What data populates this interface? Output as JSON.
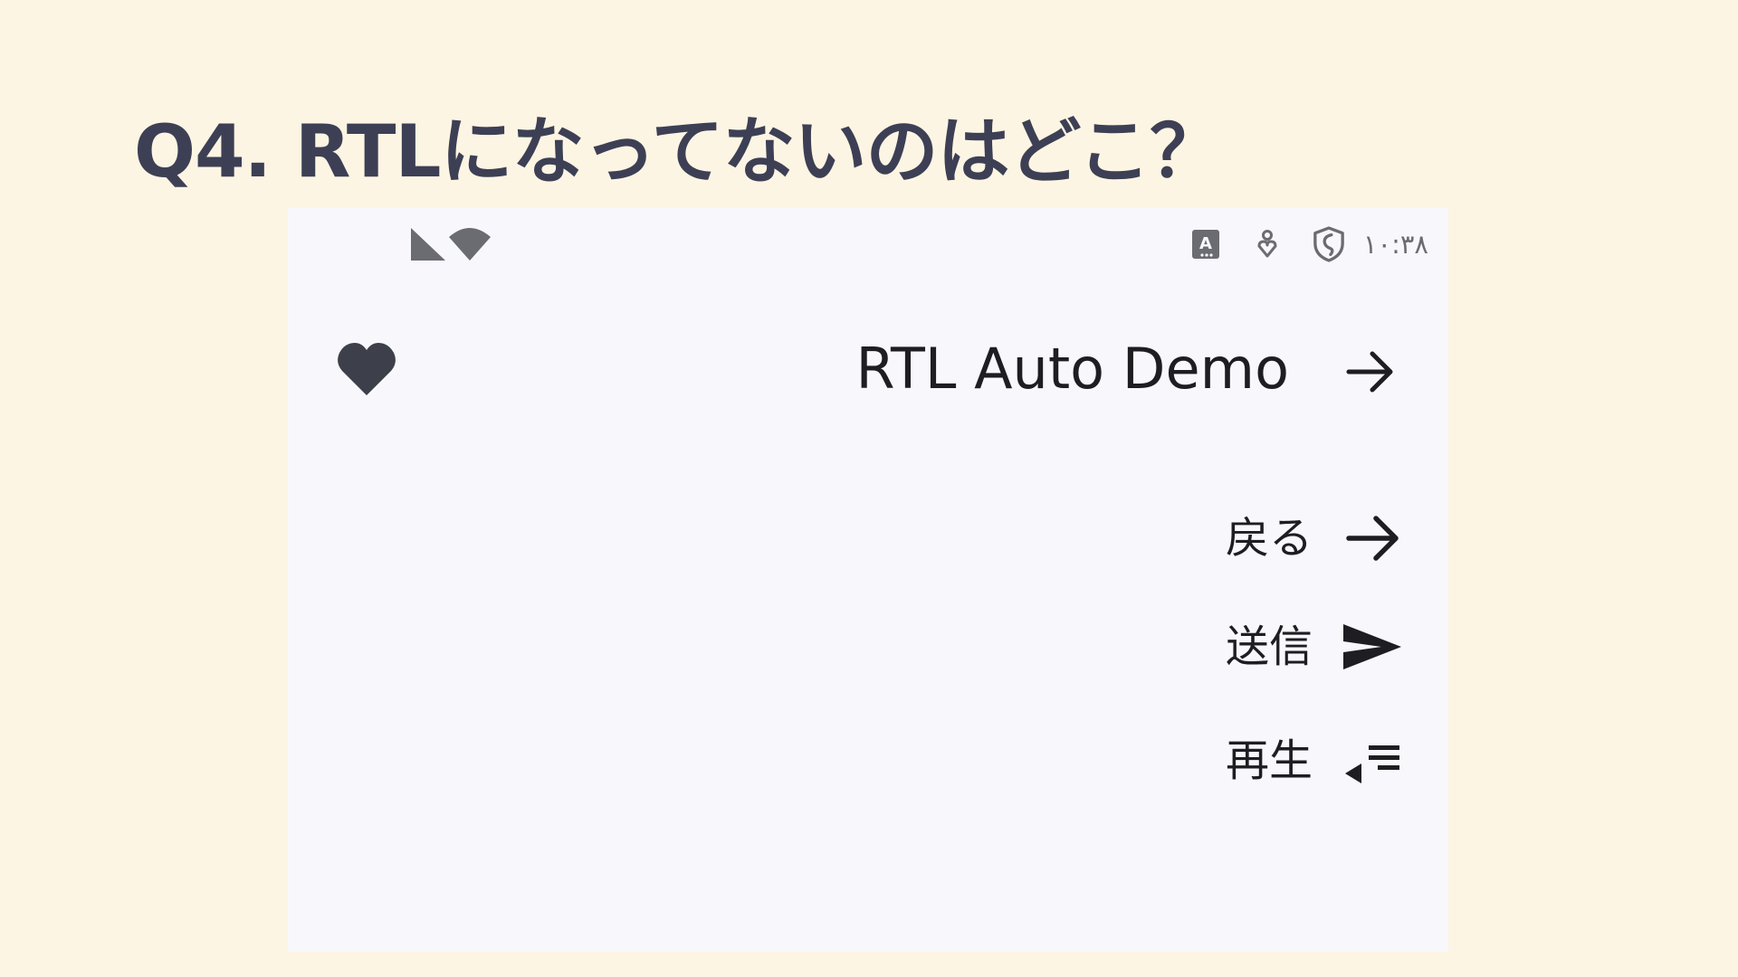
{
  "slide": {
    "title": "Q4. RTLになってないのはどこ？"
  },
  "status_bar": {
    "time": "١٠:٣٨",
    "left_icons": [
      "signal-icon",
      "wifi-icon"
    ],
    "right_icons": [
      "translate-icon",
      "accessibility-icon",
      "shield-icon"
    ]
  },
  "app_bar": {
    "title": "RTL Auto Demo",
    "leading_icon": "heart-icon",
    "trailing_icon": "arrow-right-icon"
  },
  "items": [
    {
      "label": "戻る",
      "icon": "arrow-right-icon"
    },
    {
      "label": "送信",
      "icon": "send-icon"
    },
    {
      "label": "再生",
      "icon": "play-list-icon"
    }
  ],
  "colors": {
    "slide_background": "#fdf5e3",
    "screen_background": "#f8f8fc",
    "title_text": "#3d3f55",
    "icon_gray": "#6b6b72",
    "text_dark": "#1d1d22"
  }
}
